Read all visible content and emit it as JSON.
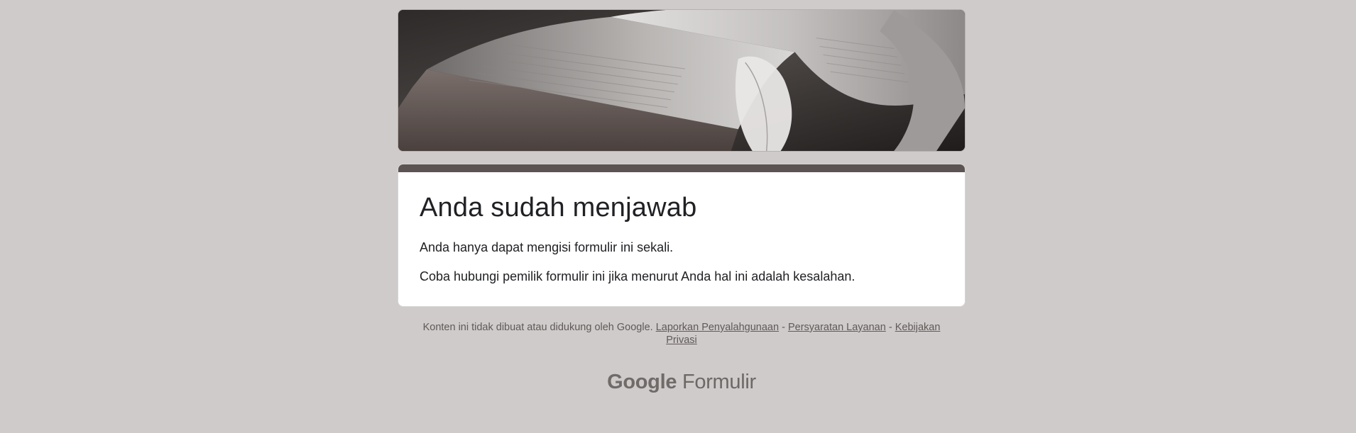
{
  "page": {
    "background": "#cfcbca",
    "accent": "#5b5452"
  },
  "header": {
    "image_alt": "open-book-with-feather"
  },
  "card": {
    "title": "Anda sudah menjawab",
    "message_1": "Anda hanya dapat mengisi formulir ini sekali.",
    "message_2": "Coba hubungi pemilik formulir ini jika menurut Anda hal ini adalah kesalahan."
  },
  "footer": {
    "disclaimer": "Konten ini tidak dibuat atau didukung oleh Google.",
    "link_report": "Laporkan Penyalahgunaan",
    "separator": "-",
    "link_terms": "Persyaratan Layanan",
    "link_privacy": "Kebijakan Privasi"
  },
  "brand": {
    "google": "Google",
    "product": "Formulir"
  }
}
